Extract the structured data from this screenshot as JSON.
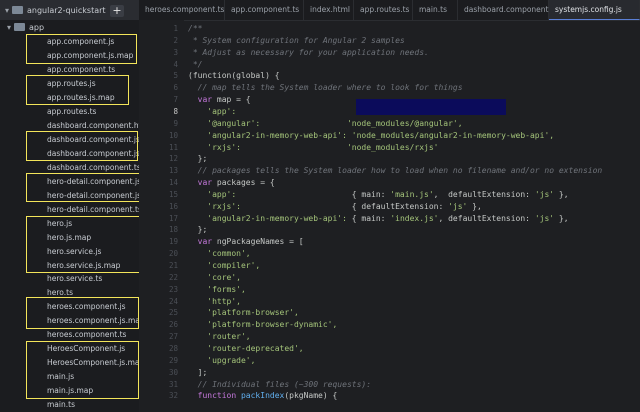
{
  "sidebar": {
    "project_name": "angular2-quickstart",
    "add_button": "+",
    "app_folder": "app",
    "files": [
      "app.component.js",
      "app.component.js.map",
      "app.component.ts",
      "app.routes.js",
      "app.routes.js.map",
      "app.routes.ts",
      "dashboard.component.html",
      "dashboard.component.js",
      "dashboard.component.js.m",
      "dashboard.component.ts",
      "hero-detail.component.js",
      "hero-detail.component.js.m",
      "hero-detail.component.ts",
      "hero.js",
      "hero.js.map",
      "hero.service.js",
      "hero.service.js.map",
      "hero.service.ts",
      "hero.ts",
      "heroes.component.js",
      "heroes.component.js.map",
      "heroes.component.ts",
      "HeroesComponent.js",
      "HeroesComponent.js.map",
      "main.js",
      "main.js.map",
      "main.ts"
    ]
  },
  "tabs": [
    {
      "label": "heroes.component.ts",
      "active": false
    },
    {
      "label": "app.component.ts",
      "active": false
    },
    {
      "label": "index.html",
      "active": false
    },
    {
      "label": "app.routes.ts",
      "active": false
    },
    {
      "label": "main.ts",
      "active": false
    },
    {
      "label": "dashboard.component.ts",
      "active": false
    },
    {
      "label": "systemjs.config.js",
      "active": true
    }
  ],
  "editor": {
    "current_line": "8",
    "line_numbers": [
      "1",
      "2",
      "3",
      "4",
      "5",
      "6",
      "7",
      "8",
      "9",
      "10",
      "11",
      "12",
      "13",
      "14",
      "15",
      "16",
      "17",
      "18",
      "19",
      "20",
      "21",
      "22",
      "23",
      "24",
      "25",
      "26",
      "27",
      "28",
      "29",
      "30",
      "31",
      "32"
    ],
    "lines": [
      [
        [
          "c-com",
          "/**"
        ]
      ],
      [
        [
          "c-com",
          " * System configuration for Angular 2 samples"
        ]
      ],
      [
        [
          "c-com",
          " * Adjust as necessary for your application needs."
        ]
      ],
      [
        [
          "c-com",
          " */"
        ]
      ],
      [
        [
          "c-pl",
          "(function(global) {"
        ]
      ],
      [
        [
          "c-com",
          "  // map tells the System loader where to look for things"
        ]
      ],
      [
        [
          "c-kw",
          "  var "
        ],
        [
          "c-pl",
          "map = {"
        ]
      ],
      [
        [
          "c-str",
          "    'app':"
        ]
      ],
      [
        [
          "c-str",
          "    '@angular':"
        ],
        [
          "c-str",
          "                  'node_modules/@angular',"
        ]
      ],
      [
        [
          "c-str",
          "    'angular2-in-memory-web-api':"
        ],
        [
          "c-pl",
          " "
        ],
        [
          "c-str",
          "'node_modules/angular2-in-memory-web-api',"
        ]
      ],
      [
        [
          "c-str",
          "    'rxjs':"
        ],
        [
          "c-str",
          "                      'node_modules/rxjs'"
        ]
      ],
      [
        [
          "c-pl",
          "  };"
        ]
      ],
      [
        [
          "c-com",
          "  // packages tells the System loader how to load when no filename and/or no extension"
        ]
      ],
      [
        [
          "c-kw",
          "  var "
        ],
        [
          "c-pl",
          "packages = {"
        ]
      ],
      [
        [
          "c-str",
          "    'app':"
        ],
        [
          "c-pl",
          "                        { main: "
        ],
        [
          "c-str",
          "'main.js'"
        ],
        [
          "c-pl",
          ",  defaultExtension: "
        ],
        [
          "c-str",
          "'js'"
        ],
        [
          "c-pl",
          " },"
        ]
      ],
      [
        [
          "c-str",
          "    'rxjs':"
        ],
        [
          "c-pl",
          "                       { defaultExtension: "
        ],
        [
          "c-str",
          "'js'"
        ],
        [
          "c-pl",
          " },"
        ]
      ],
      [
        [
          "c-str",
          "    'angular2-in-memory-web-api':"
        ],
        [
          "c-pl",
          " { main: "
        ],
        [
          "c-str",
          "'index.js'"
        ],
        [
          "c-pl",
          ", defaultExtension: "
        ],
        [
          "c-str",
          "'js'"
        ],
        [
          "c-pl",
          " },"
        ]
      ],
      [
        [
          "c-pl",
          "  };"
        ]
      ],
      [
        [
          "c-kw",
          "  var "
        ],
        [
          "c-pl",
          "ngPackageNames = ["
        ]
      ],
      [
        [
          "c-str",
          "    'common',"
        ]
      ],
      [
        [
          "c-str",
          "    'compiler',"
        ]
      ],
      [
        [
          "c-str",
          "    'core',"
        ]
      ],
      [
        [
          "c-str",
          "    'forms',"
        ]
      ],
      [
        [
          "c-str",
          "    'http',"
        ]
      ],
      [
        [
          "c-str",
          "    'platform-browser',"
        ]
      ],
      [
        [
          "c-str",
          "    'platform-browser-dynamic',"
        ]
      ],
      [
        [
          "c-str",
          "    'router',"
        ]
      ],
      [
        [
          "c-str",
          "    'router-deprecated',"
        ]
      ],
      [
        [
          "c-str",
          "    'upgrade',"
        ]
      ],
      [
        [
          "c-pl",
          "  ];"
        ]
      ],
      [
        [
          "c-com",
          "  // Individual files (~300 requests):"
        ]
      ],
      [
        [
          "c-kw",
          "  function "
        ],
        [
          "c-fn",
          "packIndex"
        ],
        [
          "c-pl",
          "(pkgName) {"
        ]
      ]
    ]
  }
}
